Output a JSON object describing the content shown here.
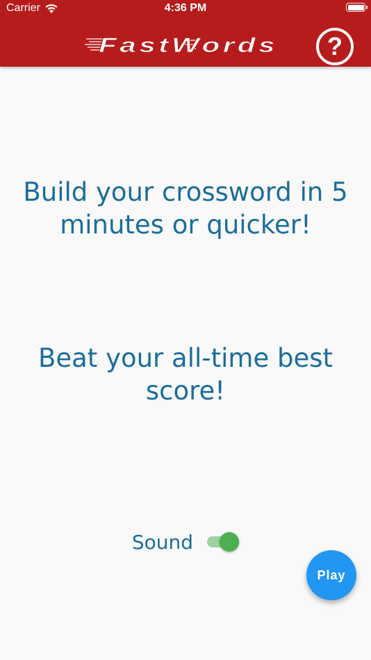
{
  "status_bar": {
    "carrier": "Carrier",
    "time": "4:36 PM",
    "wifi_icon": "wifi-icon",
    "battery_icon": "battery-icon",
    "battery_level": 1.0
  },
  "app_bar": {
    "logo_text": "FastWords",
    "help_icon": "question-circle-icon",
    "help_glyph": "?",
    "background_color": "#b71c1c"
  },
  "main": {
    "message1_lines": [
      "Build your crossword in 5",
      "minutes or quicker!"
    ],
    "message2_lines": [
      "Beat your all-time best",
      "score!"
    ],
    "text_color": "#1a6d9a"
  },
  "sound": {
    "label": "Sound",
    "enabled": true,
    "toggle_color": "#4caf50"
  },
  "play_button": {
    "label": "Play",
    "color": "#2196f3"
  }
}
